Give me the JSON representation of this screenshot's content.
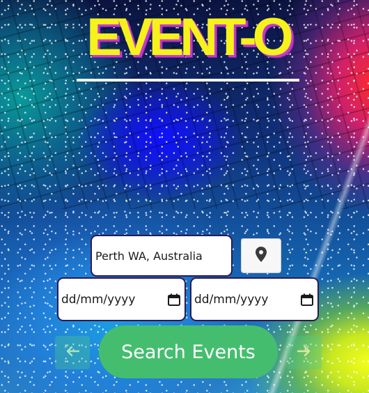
{
  "app": {
    "logo_text": "EVENT-O"
  },
  "search": {
    "location_value": "Perth WA, Australia",
    "start_date_placeholder": "dd/mm/yyyy",
    "end_date_placeholder": "dd/mm/yyyy",
    "search_label": "Search Events"
  },
  "icons": {
    "location": "map-marker-icon",
    "calendar": "calendar-icon",
    "prev": "arrow-left-icon",
    "next": "arrow-right-icon"
  },
  "colors": {
    "logo": "#f7f21a",
    "logo_shadow": "#c43ad0",
    "search_button": "#44be6e",
    "field_border": "#2a1a52"
  }
}
